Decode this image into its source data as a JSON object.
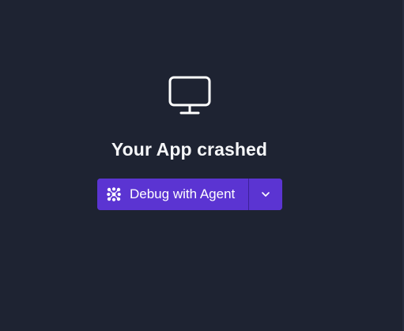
{
  "crash": {
    "icon": "monitor-icon",
    "title": "Your App crashed"
  },
  "actions": {
    "primary_label": "Debug with Agent",
    "primary_icon": "agent-icon",
    "menu_icon": "chevron-down-icon"
  },
  "colors": {
    "background": "#1e2332",
    "button": "#5b34d2",
    "text": "#f5f6f8"
  }
}
